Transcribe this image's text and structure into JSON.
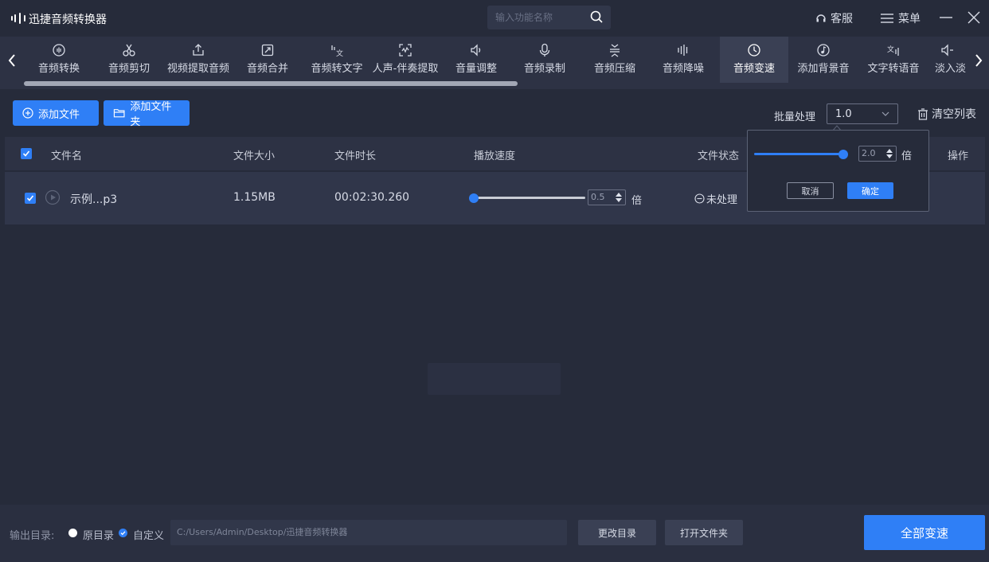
{
  "app": {
    "title": "迅捷音频转换器"
  },
  "search": {
    "placeholder": "输入功能名称"
  },
  "header": {
    "service": "客服",
    "menu": "菜单"
  },
  "tools": [
    {
      "label": "音频转换",
      "icon": "audio-convert-icon"
    },
    {
      "label": "音频剪切",
      "icon": "scissors-icon"
    },
    {
      "label": "视频提取音频",
      "icon": "upload-icon"
    },
    {
      "label": "音频合并",
      "icon": "merge-icon"
    },
    {
      "label": "音频转文字",
      "icon": "speech-to-text-icon"
    },
    {
      "label": "人声-伴奏提取",
      "icon": "vocal-extract-icon"
    },
    {
      "label": "音量调整",
      "icon": "volume-icon"
    },
    {
      "label": "音频录制",
      "icon": "microphone-icon"
    },
    {
      "label": "音频压缩",
      "icon": "compress-icon"
    },
    {
      "label": "音频降噪",
      "icon": "denoise-icon"
    },
    {
      "label": "音频变速",
      "icon": "speed-icon",
      "active": true
    },
    {
      "label": "添加背景音",
      "icon": "music-note-icon"
    },
    {
      "label": "文字转语音",
      "icon": "text-to-speech-icon"
    },
    {
      "label": "淡入淡",
      "icon": "fade-icon"
    }
  ],
  "actions": {
    "add_file": "添加文件",
    "add_folder": "添加文件夹",
    "batch_label": "批量处理",
    "batch_value": "1.0",
    "clear_list": "清空列表"
  },
  "table": {
    "headers": {
      "name": "文件名",
      "size": "文件大小",
      "duration": "文件时长",
      "speed": "播放速度",
      "status": "文件状态",
      "ops": "操作"
    },
    "rows": [
      {
        "name": "示例...p3",
        "size": "1.15MB",
        "duration": "00:02:30.260",
        "speed_value": "0.5",
        "speed_unit": "倍",
        "status": "未处理",
        "checked": true,
        "speed_fraction": 0
      }
    ]
  },
  "popup": {
    "value": "2.0",
    "unit": "倍",
    "cancel": "取消",
    "confirm": "确定",
    "speed_fraction": 1
  },
  "footer": {
    "output_label": "输出目录:",
    "opt_original": "原目录",
    "opt_custom": "自定义",
    "path": "C:/Users/Admin/Desktop/迅捷音频转换器",
    "change_dir": "更改目录",
    "open_folder": "打开文件夹",
    "run_all": "全部变速"
  },
  "colors": {
    "accent": "#2f7ff6",
    "background": "#262b3a",
    "panel": "#2d3244"
  }
}
